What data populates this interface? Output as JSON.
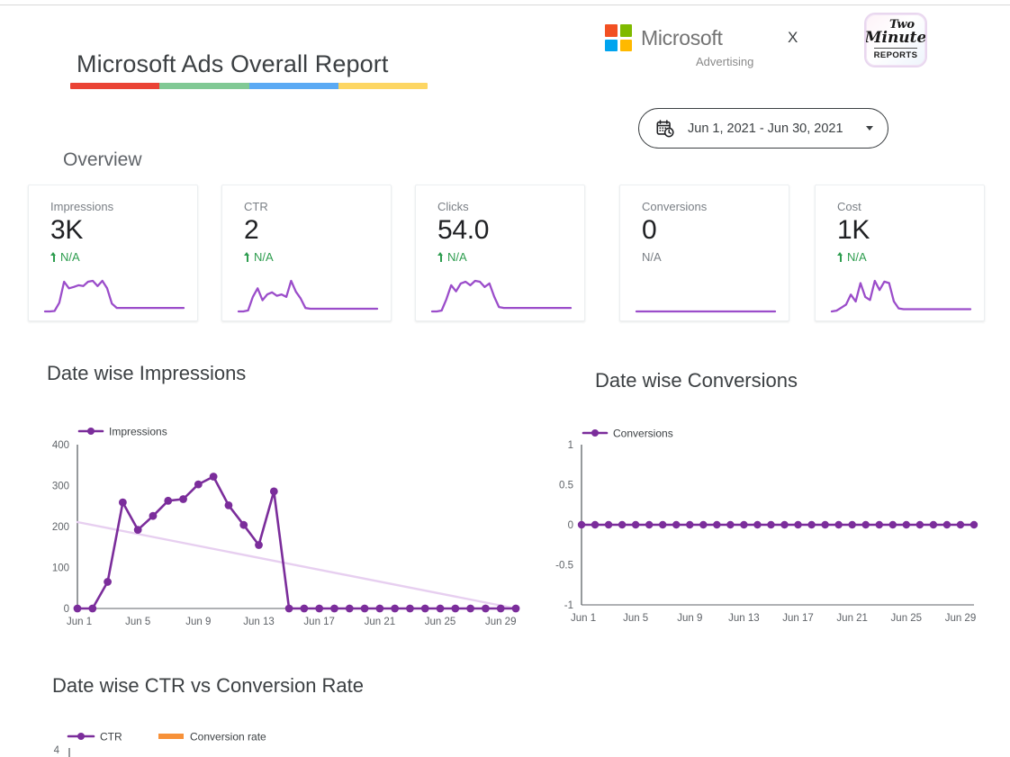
{
  "header": {
    "report_title": "Microsoft Ads Overall Report",
    "title_bar_colors": [
      "#EA4335",
      "#81C995",
      "#5BAAF4",
      "#FDD663"
    ],
    "brand": {
      "name": "Microsoft",
      "sub": "Advertising",
      "separator": "X",
      "logo_colors": [
        "#F25022",
        "#7FBA00",
        "#00A4EF",
        "#FFB900"
      ]
    },
    "partner_logo": {
      "line1": "Two",
      "line2": "Minute",
      "line3": "REPORTS"
    },
    "date_range": {
      "value": "Jun 1, 2021 - Jun 30, 2021",
      "icon": "calendar-clock-icon"
    }
  },
  "overview": {
    "heading": "Overview",
    "cards": [
      {
        "label": "Impressions",
        "value": "3K",
        "delta": "N/A",
        "delta_dir": "up",
        "spark": [
          2,
          2,
          3,
          22,
          70,
          55,
          58,
          62,
          60,
          70,
          72,
          60,
          72,
          55,
          20,
          10,
          10,
          10,
          10,
          10,
          10,
          10,
          10,
          10,
          10,
          10,
          10,
          10,
          10,
          10
        ]
      },
      {
        "label": "CTR",
        "value": "2",
        "delta": "N/A",
        "delta_dir": "up",
        "spark": [
          2,
          2,
          5,
          45,
          70,
          35,
          52,
          58,
          48,
          52,
          45,
          92,
          60,
          40,
          12,
          10,
          10,
          10,
          10,
          10,
          10,
          10,
          10,
          10,
          10,
          10,
          10,
          10,
          10,
          10
        ]
      },
      {
        "label": "Clicks",
        "value": "54.0",
        "delta": "N/A",
        "delta_dir": "up",
        "spark": [
          2,
          2,
          4,
          30,
          62,
          48,
          66,
          70,
          62,
          72,
          70,
          58,
          66,
          36,
          12,
          10,
          10,
          10,
          10,
          10,
          10,
          10,
          10,
          10,
          10,
          10,
          10,
          10,
          10,
          10
        ]
      },
      {
        "label": "Conversions",
        "value": "0",
        "delta": "N/A",
        "delta_dir": "flat",
        "spark": [
          10,
          10,
          10,
          10,
          10,
          10,
          10,
          10,
          10,
          10,
          10,
          10,
          10,
          10,
          10,
          10,
          10,
          10,
          10,
          10,
          10,
          10,
          10,
          10,
          10,
          10,
          10,
          10,
          10,
          10
        ]
      },
      {
        "label": "Cost",
        "value": "1K",
        "delta": "N/A",
        "delta_dir": "up",
        "spark": [
          4,
          6,
          14,
          22,
          48,
          30,
          78,
          42,
          34,
          84,
          60,
          82,
          78,
          30,
          12,
          10,
          10,
          10,
          10,
          10,
          10,
          10,
          10,
          10,
          10,
          10,
          10,
          10,
          10,
          10
        ]
      }
    ]
  },
  "charts": {
    "impressions_title": "Date wise Impressions",
    "conversions_title": "Date wise Conversions",
    "ctr_title": "Date wise CTR vs Conversion Rate"
  },
  "chart_data": [
    {
      "type": "line",
      "title": "Date wise Impressions",
      "xlabel": "",
      "ylabel": "",
      "ylim": [
        0,
        400
      ],
      "yticks": [
        "0",
        "100",
        "200",
        "300",
        "400"
      ],
      "xticks": [
        "Jun 1",
        "Jun 5",
        "Jun 9",
        "Jun 13",
        "Jun 17",
        "Jun 21",
        "Jun 25",
        "Jun 29"
      ],
      "x": [
        "Jun 1",
        "Jun 2",
        "Jun 3",
        "Jun 4",
        "Jun 5",
        "Jun 6",
        "Jun 7",
        "Jun 8",
        "Jun 9",
        "Jun 10",
        "Jun 11",
        "Jun 12",
        "Jun 13",
        "Jun 14",
        "Jun 15",
        "Jun 16",
        "Jun 17",
        "Jun 18",
        "Jun 19",
        "Jun 20",
        "Jun 21",
        "Jun 22",
        "Jun 23",
        "Jun 24",
        "Jun 25",
        "Jun 26",
        "Jun 27",
        "Jun 28",
        "Jun 29",
        "Jun 30"
      ],
      "legend": [
        "Impressions"
      ],
      "legend_position": "top-left",
      "grid": false,
      "series": [
        {
          "name": "Impressions",
          "color": "#7B2D9B",
          "values": [
            0,
            0,
            65,
            259,
            192,
            226,
            263,
            267,
            303,
            322,
            252,
            204,
            155,
            286,
            0,
            0,
            0,
            0,
            0,
            0,
            0,
            0,
            0,
            0,
            0,
            0,
            0,
            0,
            0,
            0
          ]
        }
      ],
      "trendline": {
        "name": "trend",
        "color": "#E7CFF0",
        "from": 211,
        "to": 0
      }
    },
    {
      "type": "line",
      "title": "Date wise Conversions",
      "xlabel": "",
      "ylabel": "",
      "ylim": [
        -1,
        1
      ],
      "yticks": [
        "-1",
        "-0.5",
        "0",
        "0.5",
        "1"
      ],
      "xticks": [
        "Jun 1",
        "Jun 5",
        "Jun 9",
        "Jun 13",
        "Jun 17",
        "Jun 21",
        "Jun 25",
        "Jun 29"
      ],
      "x": [
        "Jun 1",
        "Jun 2",
        "Jun 3",
        "Jun 4",
        "Jun 5",
        "Jun 6",
        "Jun 7",
        "Jun 8",
        "Jun 9",
        "Jun 10",
        "Jun 11",
        "Jun 12",
        "Jun 13",
        "Jun 14",
        "Jun 15",
        "Jun 16",
        "Jun 17",
        "Jun 18",
        "Jun 19",
        "Jun 20",
        "Jun 21",
        "Jun 22",
        "Jun 23",
        "Jun 24",
        "Jun 25",
        "Jun 26",
        "Jun 27",
        "Jun 28",
        "Jun 29",
        "Jun 30"
      ],
      "legend": [
        "Conversions"
      ],
      "legend_position": "top-left",
      "grid": false,
      "series": [
        {
          "name": "Conversions",
          "color": "#7B2D9B",
          "values": [
            0,
            0,
            0,
            0,
            0,
            0,
            0,
            0,
            0,
            0,
            0,
            0,
            0,
            0,
            0,
            0,
            0,
            0,
            0,
            0,
            0,
            0,
            0,
            0,
            0,
            0,
            0,
            0,
            0,
            0
          ]
        }
      ]
    },
    {
      "type": "line",
      "title": "Date wise CTR vs Conversion Rate",
      "xlabel": "",
      "ylabel": "",
      "yticks": [
        "4"
      ],
      "legend": [
        "CTR",
        "Conversion rate"
      ],
      "legend_position": "top-left",
      "grid": false,
      "truncated": true,
      "series": [
        {
          "name": "CTR",
          "color": "#7B2D9B",
          "values": []
        },
        {
          "name": "Conversion rate",
          "color": "#F79139",
          "values": []
        }
      ]
    }
  ]
}
